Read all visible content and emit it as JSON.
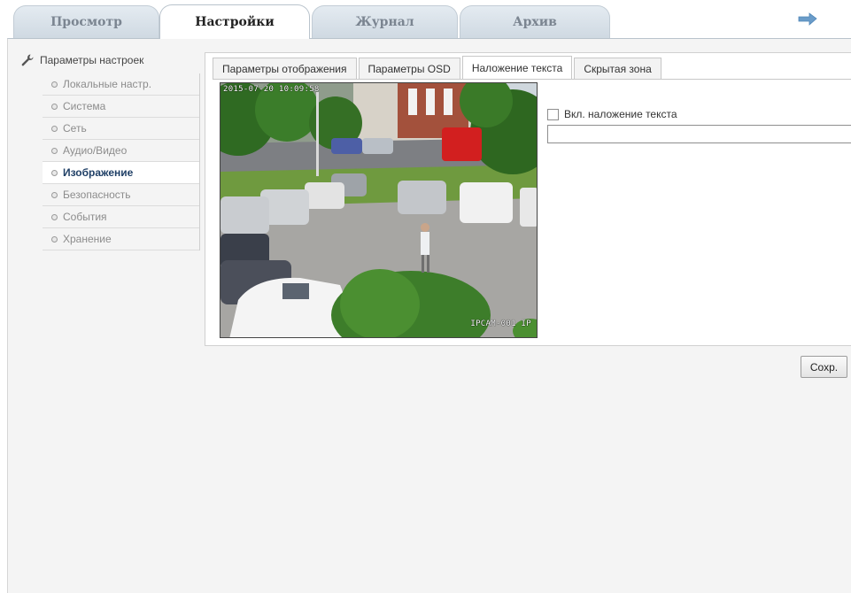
{
  "top_tabs": [
    {
      "label": "Просмотр",
      "active": false
    },
    {
      "label": "Настройки",
      "active": true
    },
    {
      "label": "Журнал",
      "active": false
    },
    {
      "label": "Архив",
      "active": false
    }
  ],
  "logout_icon": "arrow-right-icon",
  "sidebar": {
    "header": "Параметры настроек",
    "header_icon": "wrench-icon",
    "items": [
      {
        "label": "Локальные настр.",
        "active": false
      },
      {
        "label": "Система",
        "active": false
      },
      {
        "label": "Сеть",
        "active": false
      },
      {
        "label": "Аудио/Видео",
        "active": false
      },
      {
        "label": "Изображение",
        "active": true
      },
      {
        "label": "Безопасность",
        "active": false
      },
      {
        "label": "События",
        "active": false
      },
      {
        "label": "Хранение",
        "active": false
      }
    ]
  },
  "sub_tabs": [
    {
      "label": "Параметры отображения",
      "active": false
    },
    {
      "label": "Параметры OSD",
      "active": false
    },
    {
      "label": "Наложение текста",
      "active": true
    },
    {
      "label": "Скрытая зона",
      "active": false
    }
  ],
  "preview": {
    "timestamp": "2015-07-20 10:09:58",
    "camera_name": "IPCAM-001 IP"
  },
  "overlay": {
    "checkbox_label": "Вкл. наложение текста",
    "checked": false,
    "text_value": ""
  },
  "save_label": "Сохр.",
  "colors": {
    "active_sidebar_text": "#1f3f66",
    "tab_inactive": "#cfd9e2",
    "logout_arrow": "#6a9cc9"
  }
}
